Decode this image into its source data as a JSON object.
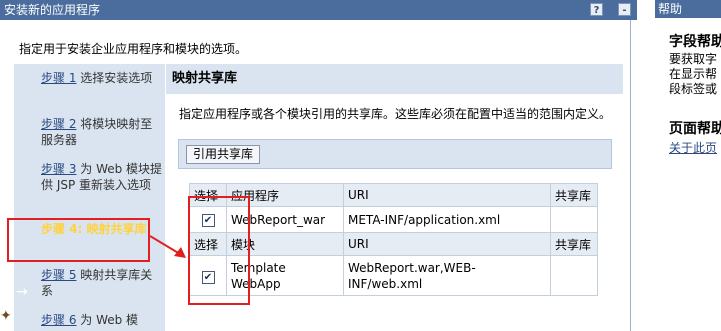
{
  "main": {
    "title": "安装新的应用程序",
    "help_btn": "?",
    "min_btn": "-",
    "subtitle": "指定用于安装企业应用程序和模块的选项。"
  },
  "steps": [
    {
      "link": "步骤 1",
      "text": " 选择安装选项"
    },
    {
      "link": "步骤 2",
      "text": " 将模块映射至服务器"
    },
    {
      "link": "步骤 3",
      "text": " 为 Web 模块提供 JSP 重新装入选项"
    },
    {
      "current": "步骤 4: 映射共享库"
    },
    {
      "link": "步骤 5",
      "text": " 映射共享库关系"
    },
    {
      "link": "步骤 6",
      "text": " 为 Web 模"
    }
  ],
  "section": {
    "title": "映射共享库",
    "description": "指定应用程序或各个模块引用的共享库。这些库必须在配置中适当的范围内定义。",
    "button": "引用共享库"
  },
  "table": {
    "app_header": [
      "选择",
      "应用程序",
      "URI",
      "共享库"
    ],
    "app_rows": [
      {
        "checked": true,
        "name": "WebReport_war",
        "uri": "META-INF/application.xml",
        "lib": ""
      }
    ],
    "mod_header": [
      "选择",
      "模块",
      "URI",
      "共享库"
    ],
    "mod_rows": [
      {
        "checked": true,
        "name": "Template WebApp",
        "uri": "WebReport.war,WEB-INF/web.xml",
        "lib": ""
      }
    ]
  },
  "help": {
    "title": "帮助",
    "heading1": "字段帮助",
    "text": [
      "要获取字",
      "在显示帮",
      "段标签或"
    ],
    "heading2": "页面帮助",
    "link": "关于此页"
  },
  "colors": {
    "titlebar": "#4a6d9e",
    "sidebar": "#d9e4f0",
    "current_step": "#ffd23f",
    "annotation": "#e02020"
  }
}
